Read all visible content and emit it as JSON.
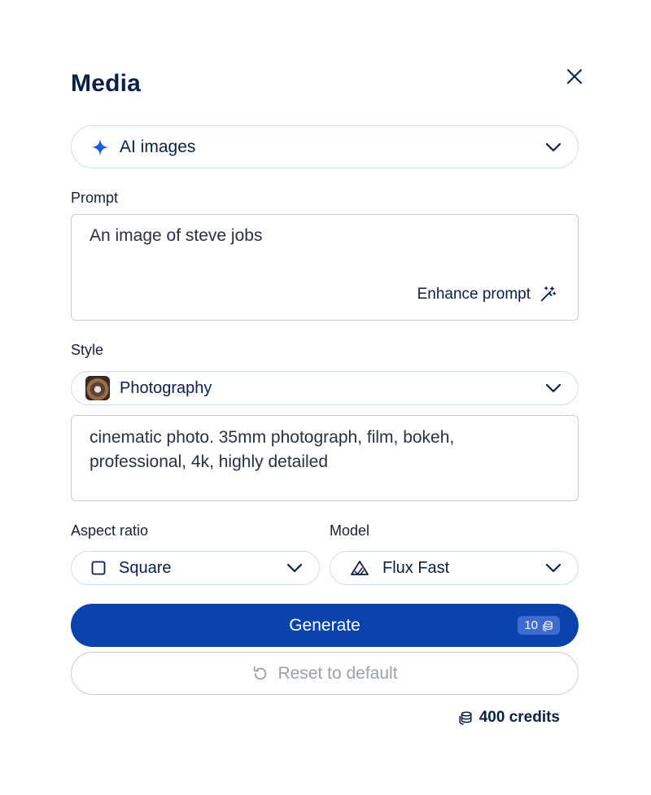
{
  "panel": {
    "title": "Media"
  },
  "media_type": {
    "selected": "AI images",
    "icon": "sparkle-icon"
  },
  "prompt": {
    "label": "Prompt",
    "value": "An image of steve jobs",
    "enhance_label": "Enhance prompt"
  },
  "style": {
    "label": "Style",
    "selected": "Photography",
    "description": "cinematic photo. 35mm photograph, film, bokeh, professional, 4k, highly detailed"
  },
  "aspect_ratio": {
    "label": "Aspect ratio",
    "selected": "Square"
  },
  "model": {
    "label": "Model",
    "selected": "Flux Fast"
  },
  "actions": {
    "generate_label": "Generate",
    "generate_cost": "10",
    "reset_label": "Reset to default"
  },
  "credits": {
    "text": "400 credits"
  },
  "colors": {
    "primary": "#0B43AD",
    "text": "#0B1F4B",
    "accent_icon": "#1C5BE0",
    "border": "#CFDCF6"
  }
}
